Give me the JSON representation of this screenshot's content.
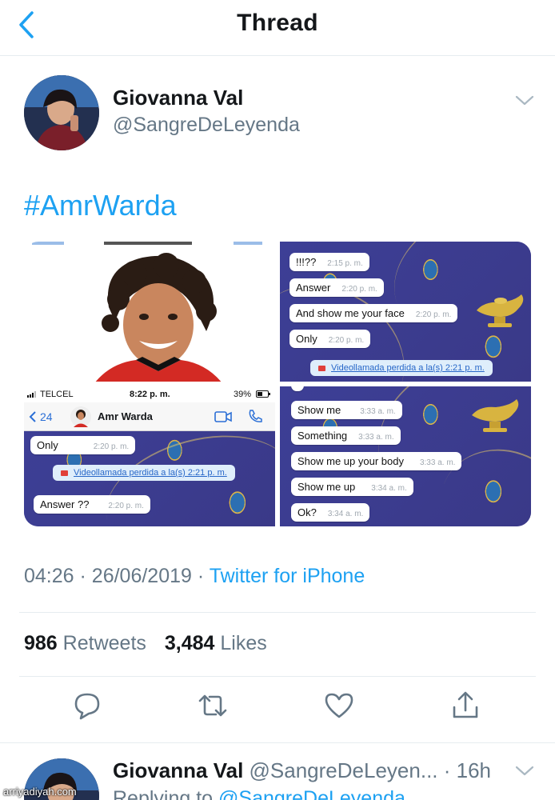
{
  "header": {
    "title": "Thread"
  },
  "tweet": {
    "author_name": "Giovanna Val",
    "author_handle": "@SangreDeLeyenda",
    "hashtag": "#AmrWarda",
    "time": "04:26",
    "date": "26/06/2019",
    "source": "Twitter for iPhone",
    "retweets_count": "986",
    "retweets_label": "Retweets",
    "likes_count": "3,484",
    "likes_label": "Likes"
  },
  "media": {
    "panel2_messages": [
      {
        "text": "!!!??",
        "time": "2:15 p. m."
      },
      {
        "text": "Answer",
        "time": "2:20 p. m."
      },
      {
        "text": "And show me your face",
        "time": "2:20 p. m."
      },
      {
        "text": "Only",
        "time": "2:20 p. m."
      }
    ],
    "panel2_missed_call": "Videollamada perdida a la(s) 2:21 p. m.",
    "panel3_status": {
      "carrier": "TELCEL",
      "time": "8:22 p. m.",
      "battery": "39%"
    },
    "panel3_nav": {
      "back_count": "24",
      "contact_name": "Amr Warda"
    },
    "panel3_messages": [
      {
        "text": "Only",
        "time": "2:20 p. m."
      },
      {
        "text": "Answer ??",
        "time": "2:20 p. m."
      }
    ],
    "panel3_missed_call": "Videollamada perdida a la(s) 2:21 p. m.",
    "panel4_messages": [
      {
        "text": "Show me",
        "time": "3:33 a. m."
      },
      {
        "text": "Something",
        "time": "3:33 a. m."
      },
      {
        "text": "Show me up your body",
        "time": "3:33 a. m."
      },
      {
        "text": "Show me up",
        "time": "3:34 a. m."
      },
      {
        "text": "Ok?",
        "time": "3:34 a. m."
      }
    ]
  },
  "reply": {
    "author_name": "Giovanna Val",
    "author_handle": "@SangreDeLeyen...",
    "age": "· 16h",
    "replying_prefix": "Replying to",
    "replying_to": "@SangreDeLeyenda"
  },
  "watermark": "arriyadiyah.com",
  "colors": {
    "accent": "#1da1f2",
    "muted": "#657786",
    "text": "#14171a",
    "divider": "#e6ecf0"
  },
  "icons": [
    "back-chevron-icon",
    "caret-down-icon",
    "reply-icon",
    "retweet-icon",
    "like-icon",
    "share-icon",
    "video-call-icon",
    "phone-icon"
  ]
}
